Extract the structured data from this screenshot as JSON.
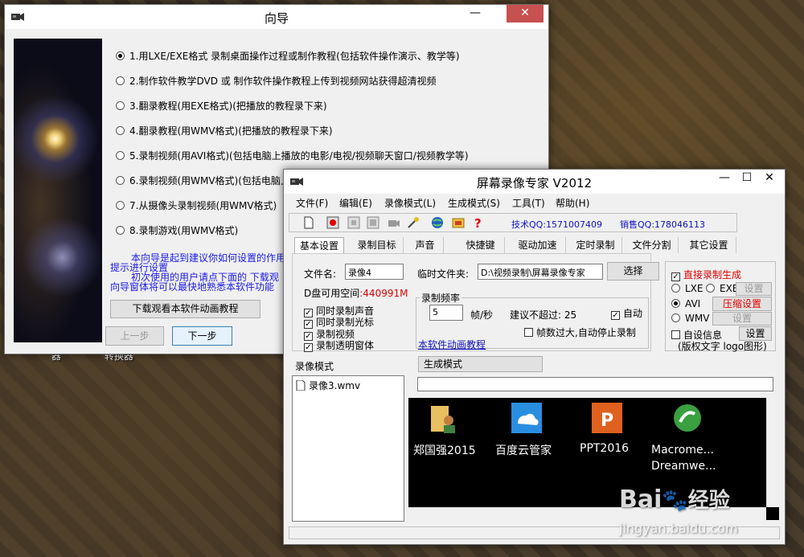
{
  "desktop": {
    "icon_labels": [
      "器",
      "转换器"
    ]
  },
  "wizard": {
    "title": "向导",
    "options": [
      "1.用LXE/EXE格式 录制桌面操作过程或制作教程(包括软件操作演示、教学等)",
      "2.制作软件教学DVD 或 制作软件操作教程上传到视频网站获得超清视频",
      "3.翻录教程(用EXE格式)(把播放的教程录下来)",
      "4.翻录教程(用WMV格式)(把播放的教程录下来)",
      "5.录制视频(用AVI格式)(包括电脑上播放的电影/电视/视频聊天窗口/视频教学等)",
      "6.录制视频(用WMV格式)(包括电脑上",
      "7.从摄像头录制视频(用WMV格式)",
      "8.录制游戏(用WMV格式)"
    ],
    "selected_index": 0,
    "note_lines": [
      "本向导是起到建议你如何设置的作用",
      "提示进行设置",
      "初次使用的用户请点下面的 下载观",
      "向导窗体将可以最快地熟悉本软件功能"
    ],
    "download_button": "下载观看本软件动画教程",
    "prev_button": "上一步",
    "next_button": "下一步"
  },
  "recorder": {
    "title": "屏幕录像专家 V2012",
    "menu": [
      "文件(F)",
      "编辑(E)",
      "录像模式(L)",
      "生成模式(S)",
      "工具(T)",
      "帮助(H)"
    ],
    "tech_qq": "技术QQ:1571007409",
    "sales_qq": "销售QQ:178046113",
    "tabs": [
      "基本设置",
      "录制目标",
      "声音",
      "快捷键",
      "驱动加速",
      "定时录制",
      "文件分割",
      "其它设置"
    ],
    "filename_label": "文件名:",
    "filename_value": "录像4",
    "tempdir_label": "临时文件夹:",
    "tempdir_value": "D:\\视频录制\\屏幕录像专家",
    "select_button": "选择",
    "disk_label": "D盘可用空间",
    "disk_value": ":440991M",
    "checkboxes": [
      "同时录制声音",
      "同时录制光标",
      "录制视频",
      "录制透明窗体"
    ],
    "freq_group_label": "录制频率",
    "freq_value": "5",
    "freq_unit": "帧/秒",
    "suggest_label": "建议不超过:",
    "suggest_value": "25",
    "auto_label": "自动",
    "overflow_label": "帧数过大,自动停止录制",
    "tutorial_link": "本软件动画教程",
    "direct_gen_label": "直接录制生成",
    "format_lxe": "LXE",
    "format_exe": "EXE",
    "format_avi": "AVI",
    "format_wmv": "WMV",
    "settings_button": "设置",
    "compress_button": "压缩设置",
    "custom_info_label": "自设信息",
    "copyright_note": "(版权文字 logo图形)",
    "record_mode_label": "录像模式",
    "gen_mode_label": "生成模式",
    "file_list": [
      "录像3.wmv"
    ],
    "preview_icons": [
      "郑国强2015",
      "百度云管家",
      "PPT2016",
      "Macrome... Dreamwe..."
    ]
  },
  "watermark": {
    "brand": "Bai",
    "brand_suffix": "经验",
    "url": "jingyan.baidu.com"
  },
  "colors": {
    "accent_red": "#e00000",
    "link_blue": "#1010c0",
    "close_red": "#c75050"
  }
}
